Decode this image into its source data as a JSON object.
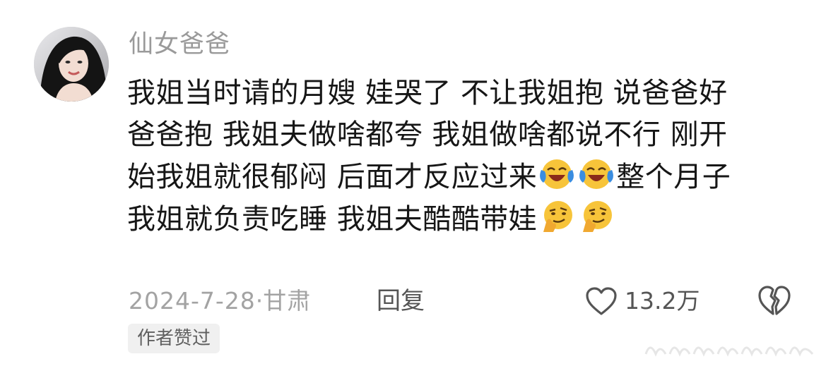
{
  "comment": {
    "username": "仙女爸爸",
    "text_lines": [
      {
        "text": "我姐当时请的月嫂 娃哭了 不让我姐抱 说爸爸好"
      },
      {
        "text": "爸爸抱 我姐夫做啥都夸 我姐做啥都说不行 刚开"
      },
      {
        "before": "始我姐就很郁闷 后面才反应过来",
        "after": "整个月子"
      },
      {
        "before": "我姐就负责吃睡 我姐夫酷酷带娃",
        "after": ""
      }
    ],
    "emojis": {
      "line3": [
        "laugh-cry-emoji",
        "laugh-cry-emoji"
      ],
      "line4": [
        "smirk-thinking-emoji",
        "smirk-thinking-emoji"
      ]
    },
    "date": "2024-7-28",
    "separator": "·",
    "location": "甘肃",
    "reply_label": "回复",
    "like_count": "13.2万",
    "author_badge": "作者赞过"
  },
  "colors": {
    "text": "#161616",
    "muted": "#a3a3a3",
    "action": "#555555",
    "badge_bg": "#f0f0f0",
    "emoji_yellow": "#f7c43a",
    "emoji_blue": "#3a8de0"
  }
}
